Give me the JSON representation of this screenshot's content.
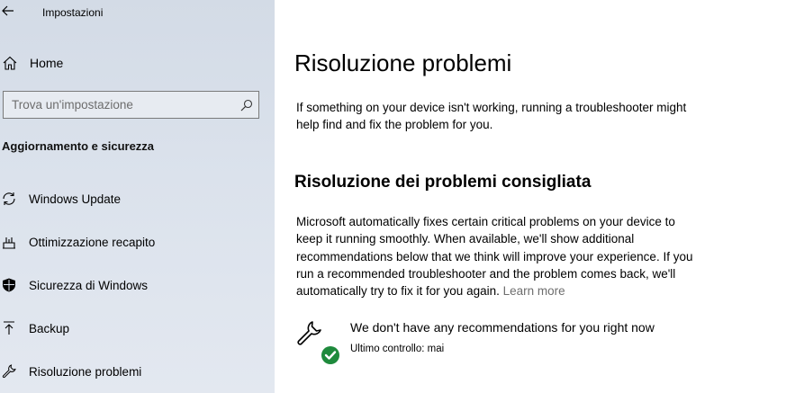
{
  "window": {
    "app_title": "Impostazioni"
  },
  "sidebar": {
    "home_label": "Home",
    "search_placeholder": "Trova un'impostazione",
    "section_title": "Aggiornamento e sicurezza",
    "items": [
      {
        "label": "Windows Update",
        "icon": "sync-icon"
      },
      {
        "label": "Ottimizzazione recapito",
        "icon": "delivery-icon"
      },
      {
        "label": "Sicurezza di Windows",
        "icon": "shield-icon"
      },
      {
        "label": "Backup",
        "icon": "backup-icon"
      },
      {
        "label": "Risoluzione problemi",
        "icon": "wrench-icon"
      }
    ]
  },
  "main": {
    "title": "Risoluzione problemi",
    "intro": "If something on your device isn't working, running a troubleshooter might help find and fix the problem for you.",
    "subtitle": "Risoluzione dei problemi consigliata",
    "description": "Microsoft automatically fixes certain critical problems on your device to keep it running smoothly. When available, we'll show additional recommendations below that we think will improve your experience. If you run a recommended troubleshooter and the problem comes back, we'll automatically try to fix it for you again.",
    "learn_more": "Learn more",
    "status_text": "We don't have any recommendations for you right now",
    "status_sub": "Ultimo controllo: mai"
  },
  "colors": {
    "check_green": "#1e8a3c",
    "link_gray": "#6e6e6e"
  }
}
